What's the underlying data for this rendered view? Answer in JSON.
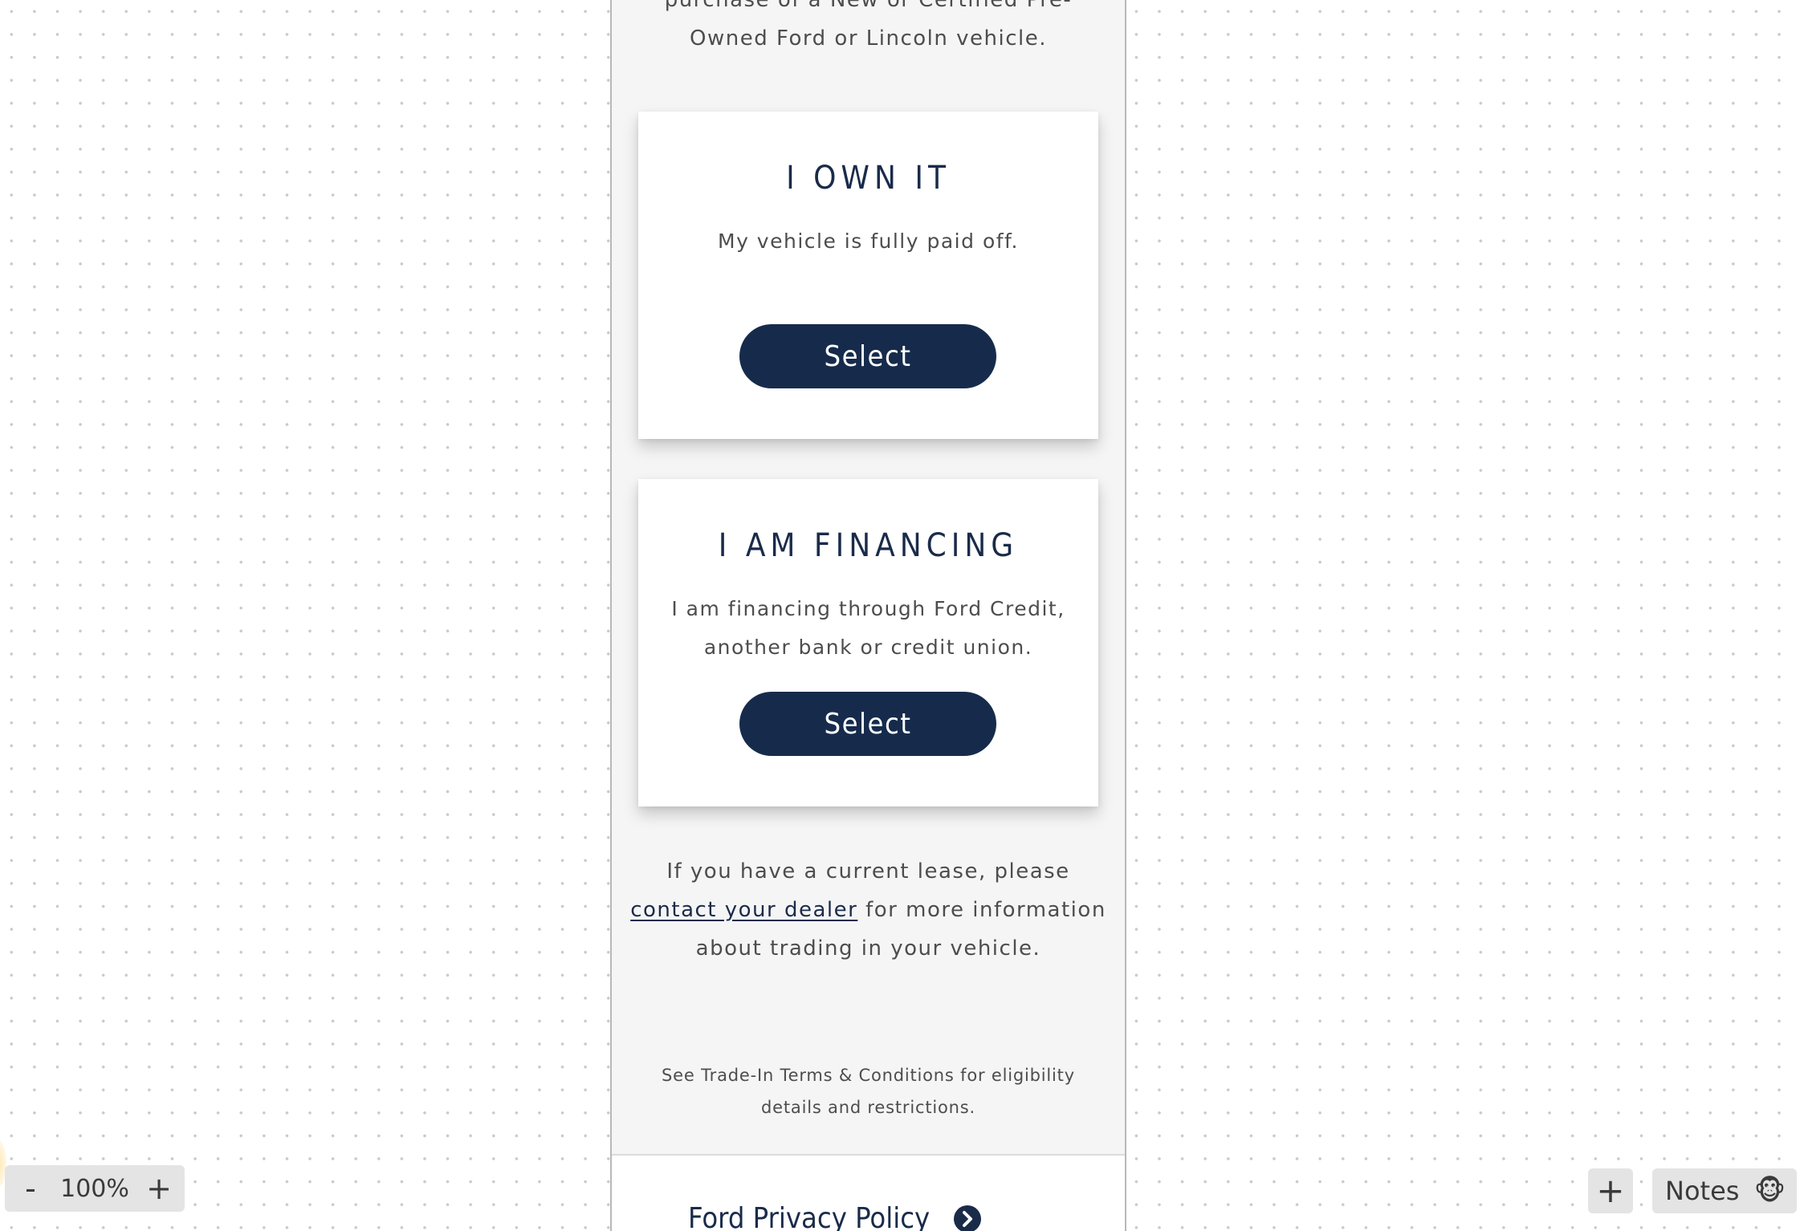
{
  "intro": {
    "text": "purchase of a New or Certified Pre-Owned Ford or Lincoln vehicle."
  },
  "cards": [
    {
      "title": "I OWN IT",
      "description": "My vehicle is fully paid off.",
      "button_label": "Select"
    },
    {
      "title": "I AM FINANCING",
      "description": "I am financing through Ford Credit, another bank or credit union.",
      "button_label": "Select"
    }
  ],
  "lease": {
    "before": "If you have a current lease, please ",
    "link_label": "contact your dealer",
    "after": " for more information about trading in your vehicle."
  },
  "terms": {
    "text": "See Trade-In Terms & Conditions for eligibility details and restrictions."
  },
  "footer": {
    "privacy_label": "Ford Privacy Policy",
    "privacy_icon": "chevron-right-circle-icon"
  },
  "toolbar": {
    "zoom_out_label": "-",
    "zoom_level": "100%",
    "zoom_in_label": "+",
    "add_label": "+",
    "notes_label": "Notes",
    "notes_icon": "🐵"
  },
  "colors": {
    "brand_navy": "#162b4c",
    "panel_bg": "#f5f5f5"
  }
}
